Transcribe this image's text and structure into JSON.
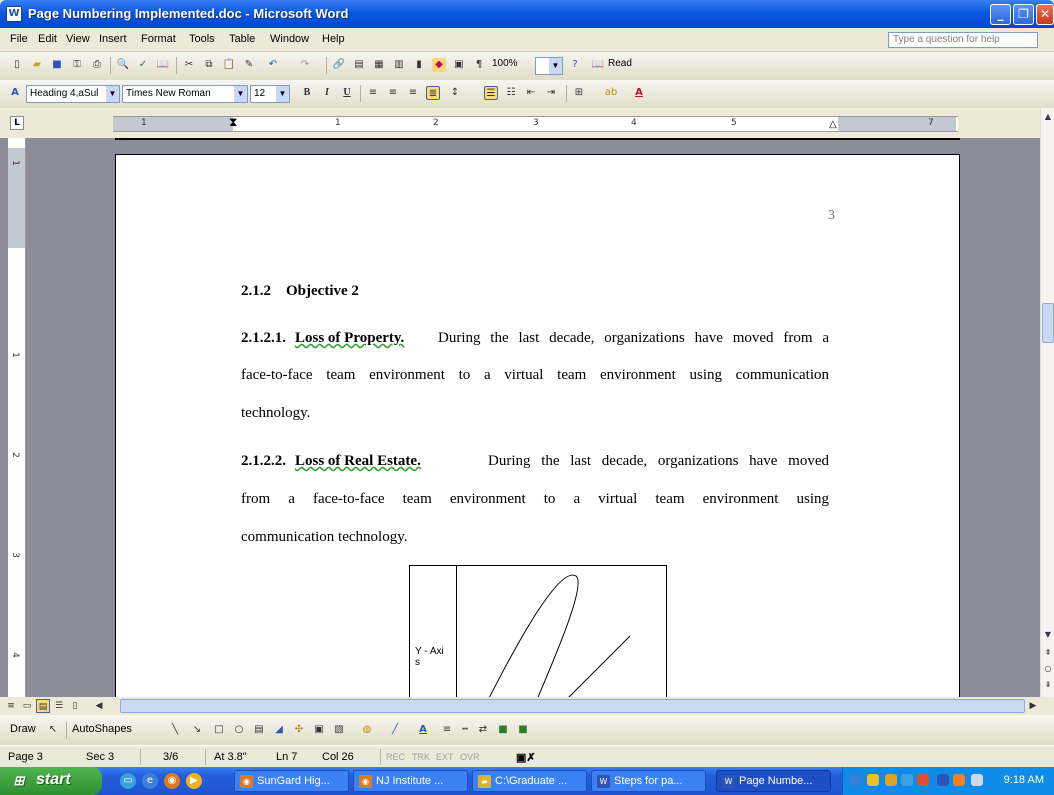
{
  "window": {
    "title": "Page Numbering Implemented.doc - Microsoft Word",
    "icon": "word-doc-icon",
    "controls": [
      "minimize-icon",
      "restore-icon",
      "close-icon"
    ]
  },
  "menu": {
    "items": [
      "File",
      "Edit",
      "View",
      "Insert",
      "Format",
      "Tools",
      "Table",
      "Window",
      "Help"
    ],
    "help_placeholder": "Type a question for help"
  },
  "standard_toolbar": {
    "zoom": "100%",
    "read_label": "Read"
  },
  "formatting_toolbar": {
    "style": "Heading 4,aSul",
    "font": "Times New Roman",
    "size": "12",
    "bold": "B",
    "italic": "I",
    "underline": "U"
  },
  "ruler": {
    "numbers": [
      "1",
      "1",
      "2",
      "3",
      "4",
      "5",
      "7"
    ],
    "vertical_numbers": [
      "1",
      "1",
      "2",
      "3",
      "4"
    ]
  },
  "document": {
    "page_number": "3",
    "heading": "2.1.2    Objective 2",
    "para1": {
      "number": "2.1.2.1.",
      "title": "Loss of Property.",
      "line1": "During the last decade, organizations have moved from a",
      "line2": "face-to-face team environment to a virtual team environment using communication",
      "line3": "technology."
    },
    "para2": {
      "number": "2.1.2.2.",
      "title": "Loss of Real Estate.",
      "line1": "During the last decade, organizations have moved",
      "line2": "from a face-to-face team environment to a virtual team environment using",
      "line3": "communication technology."
    },
    "chart": {
      "y_label": "Y - Axi s"
    }
  },
  "drawing_toolbar": {
    "draw_label": "Draw",
    "autoshapes_label": "AutoShapes"
  },
  "status_bar": {
    "page": "Page 3",
    "sec": "Sec 3",
    "pages": "3/6",
    "at": "At 3.8\"",
    "ln": "Ln 7",
    "col": "Col 26",
    "rec": "REC",
    "trk": "TRK",
    "ext": "EXT",
    "ovr": "OVR"
  },
  "taskbar": {
    "start_label": "start",
    "tasks": [
      {
        "label": "SunGard Hig...",
        "icon": "firefox-icon"
      },
      {
        "label": "NJ Institute ...",
        "icon": "firefox-icon"
      },
      {
        "label": "C:\\Graduate ...",
        "icon": "folder-icon"
      },
      {
        "label": "Steps for pa...",
        "icon": "word-doc-icon"
      },
      {
        "label": "Page Numbe...",
        "icon": "word-doc-icon"
      }
    ],
    "clock": "9:18 AM"
  }
}
